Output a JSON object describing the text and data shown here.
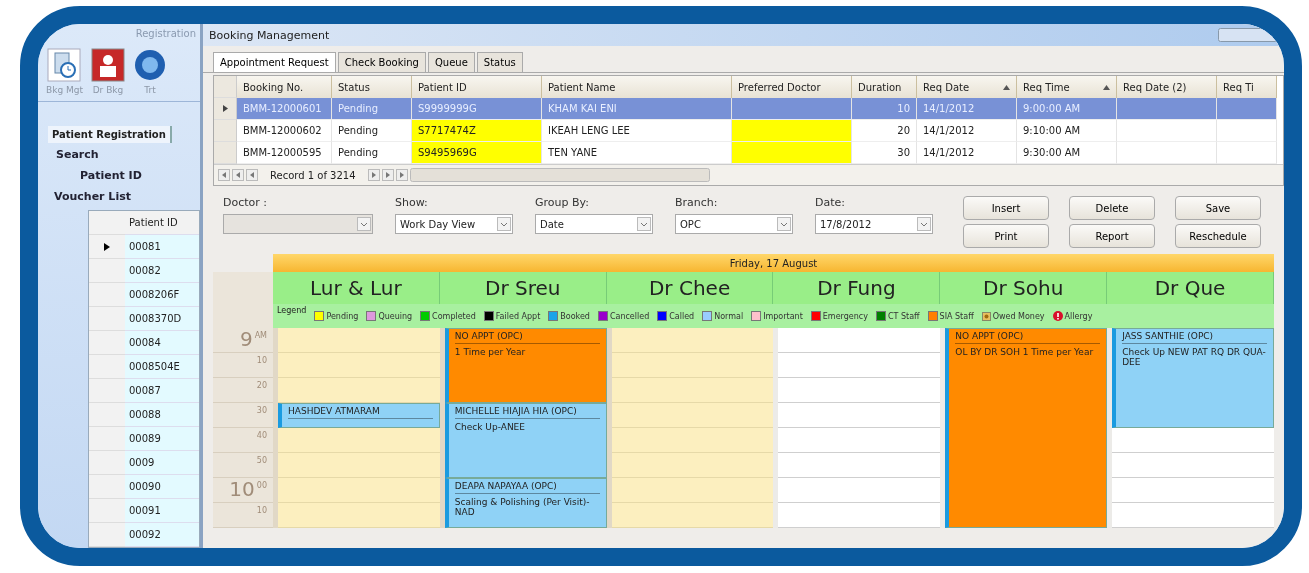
{
  "sidebar": {
    "ribbon_title": "Registration",
    "ribbon_buttons": [
      {
        "label": "Bkg Mgt",
        "kind": "clock"
      },
      {
        "label": "Dr Bkg",
        "kind": "doctor"
      },
      {
        "label": "Trt",
        "kind": "globe"
      }
    ],
    "tab": "Patient Registration",
    "search_title": "Search",
    "search_label": "Patient ID",
    "voucher_title": "Voucher List",
    "voucher_column": "Patient ID",
    "vouchers": [
      {
        "id": "00081",
        "selected": true
      },
      {
        "id": "00082",
        "selected": false
      },
      {
        "id": "0008206F",
        "selected": false
      },
      {
        "id": "0008370D",
        "selected": false
      },
      {
        "id": "00084",
        "selected": false
      },
      {
        "id": "0008504E",
        "selected": false
      },
      {
        "id": "00087",
        "selected": false
      },
      {
        "id": "00088",
        "selected": false
      },
      {
        "id": "00089",
        "selected": false
      },
      {
        "id": "0009",
        "selected": false
      },
      {
        "id": "00090",
        "selected": false
      },
      {
        "id": "00091",
        "selected": false
      },
      {
        "id": "00092",
        "selected": false
      }
    ]
  },
  "booking": {
    "title": "Booking Management",
    "tabs": [
      {
        "label": "Appointment Request",
        "selected": true
      },
      {
        "label": "Check Booking",
        "selected": false
      },
      {
        "label": "Queue",
        "selected": false
      },
      {
        "label": "Status",
        "selected": false
      }
    ],
    "table": {
      "columns": [
        {
          "label": "Booking No.",
          "sorted": false
        },
        {
          "label": "Status",
          "sorted": false
        },
        {
          "label": "Patient ID",
          "sorted": false
        },
        {
          "label": "Patient Name",
          "sorted": false
        },
        {
          "label": "Preferred Doctor",
          "sorted": false
        },
        {
          "label": "Duration",
          "sorted": false
        },
        {
          "label": "Req Date",
          "sorted": true
        },
        {
          "label": "Req Time",
          "sorted": true
        },
        {
          "label": "Req Date (2)",
          "sorted": false
        },
        {
          "label": "Req Ti",
          "sorted": false
        }
      ],
      "rows": [
        {
          "selected": true,
          "flagged": false,
          "cells": [
            "BMM-12000601",
            "Pending",
            "S9999999G",
            "KHAM KAI ENI",
            null,
            "10",
            "14/1/2012",
            "9:00:00 AM",
            null,
            null
          ]
        },
        {
          "selected": false,
          "flagged": true,
          "cells": [
            "BMM-12000602",
            "Pending",
            "S7717474Z",
            "IKEAH LENG LEE",
            null,
            "20",
            "14/1/2012",
            "9:10:00 AM",
            null,
            null
          ]
        },
        {
          "selected": false,
          "flagged": true,
          "cells": [
            "BMM-12000595",
            "Pending",
            "S9495969G",
            "TEN YANE",
            null,
            "30",
            "14/1/2012",
            "9:30:00 AM",
            null,
            null
          ]
        }
      ]
    },
    "record": "Record 1 of 3214",
    "filters": [
      {
        "label": "Doctor :",
        "disabled": true
      },
      {
        "label": "Show:",
        "value": "Work Day View",
        "disabled": false
      },
      {
        "label": "Group By:",
        "value": "Date",
        "disabled": false
      },
      {
        "label": "Branch:",
        "value": "OPC",
        "disabled": false
      },
      {
        "label": "Date:",
        "value": "17/8/2012",
        "disabled": false
      }
    ],
    "buttons": [
      "Insert",
      "Delete",
      "Save",
      "Print",
      "Report",
      "Reschedule"
    ]
  },
  "scheduler": {
    "date": "Friday, 17 August",
    "legend_title": "Legend",
    "legend": [
      {
        "label": "Pending",
        "kind": "swatch",
        "color": "#ffff00"
      },
      {
        "label": "Queuing",
        "kind": "swatch",
        "color": "#dd99dd"
      },
      {
        "label": "Completed",
        "kind": "swatch",
        "color": "#00cc00"
      },
      {
        "label": "Failed Appt",
        "kind": "swatch",
        "color": "#000000"
      },
      {
        "label": "Booked",
        "kind": "swatch",
        "color": "#1aa3e8"
      },
      {
        "label": "Cancelled",
        "kind": "swatch",
        "color": "#9900cc"
      },
      {
        "label": "Called",
        "kind": "swatch",
        "color": "#0000ff"
      },
      {
        "label": "Normal",
        "kind": "swatch",
        "color": "#99ccff"
      },
      {
        "label": "Important",
        "kind": "swatch",
        "color": "#ffc0cb"
      },
      {
        "label": "Emergency",
        "kind": "swatch",
        "color": "#ff0000"
      },
      {
        "label": "CT Staff",
        "kind": "swatch",
        "color": "#008000"
      },
      {
        "label": "SIA Staff",
        "kind": "swatch",
        "color": "#ff8000"
      },
      {
        "label": "Owed Money",
        "kind": "coin"
      },
      {
        "label": "Allergy",
        "kind": "alert"
      }
    ],
    "slots": [
      {
        "hour": "9",
        "minute": "AM"
      },
      {
        "minute": "10"
      },
      {
        "minute": "20"
      },
      {
        "minute": "30"
      },
      {
        "minute": "40"
      },
      {
        "minute": "50"
      },
      {
        "hour": "10",
        "minute": "00"
      },
      {
        "minute": "10"
      }
    ],
    "doctors": [
      {
        "name": "Lur & Lur",
        "working": true,
        "slots": [
          {
            "kind": "free"
          },
          {
            "kind": "free"
          },
          {
            "kind": "free"
          },
          {
            "kind": "booked",
            "title": "HASHDEV ATMARAM"
          },
          {
            "kind": "free"
          },
          {
            "kind": "free"
          },
          {
            "kind": "free"
          },
          {
            "kind": "free"
          }
        ]
      },
      {
        "name": "Dr Sreu",
        "working": true,
        "slots": [
          {
            "kind": "staff",
            "title": "NO APPT (OPC)",
            "note": "1 Time per Year"
          },
          {
            "kind": "continued"
          },
          {
            "kind": "continued"
          },
          {
            "kind": "booked",
            "title": "MICHELLE HIAJIA HIA (OPC)",
            "note": "Check Up-ANEE"
          },
          {
            "kind": "continued"
          },
          {
            "kind": "continued"
          },
          {
            "kind": "booked",
            "title": "DEAPA NAPAYAA (OPC)",
            "note": "Scaling & Polishing (Per Visit)- NAD"
          },
          {
            "kind": "continued"
          }
        ]
      },
      {
        "name": "Dr Chee",
        "working": true,
        "slots": [
          {
            "kind": "free"
          },
          {
            "kind": "free"
          },
          {
            "kind": "free"
          },
          {
            "kind": "free"
          },
          {
            "kind": "free"
          },
          {
            "kind": "free"
          },
          {
            "kind": "free"
          },
          {
            "kind": "free"
          }
        ]
      },
      {
        "name": "Dr Fung",
        "working": false,
        "slots": [
          {
            "kind": "free"
          },
          {
            "kind": "free"
          },
          {
            "kind": "free"
          },
          {
            "kind": "free"
          },
          {
            "kind": "free"
          },
          {
            "kind": "free"
          },
          {
            "kind": "free"
          },
          {
            "kind": "free"
          }
        ]
      },
      {
        "name": "Dr Sohu",
        "working": false,
        "slots": [
          {
            "kind": "staff",
            "title": "NO APPT (OPC)",
            "note": "OL BY DR SOH 1 Time per Year"
          },
          {
            "kind": "continued"
          },
          {
            "kind": "continued"
          },
          {
            "kind": "continued"
          },
          {
            "kind": "continued"
          },
          {
            "kind": "continued"
          },
          {
            "kind": "continued"
          },
          {
            "kind": "continued"
          }
        ]
      },
      {
        "name": "Dr Que",
        "working": false,
        "slots": [
          {
            "kind": "booked",
            "title": "JASS SANTHIE (OPC)",
            "note": "Check Up NEW PAT RQ DR QUA-DEE"
          },
          {
            "kind": "continued"
          },
          {
            "kind": "continued"
          },
          {
            "kind": "continued"
          },
          {
            "kind": "free"
          },
          {
            "kind": "free"
          },
          {
            "kind": "free"
          },
          {
            "kind": "free"
          }
        ]
      }
    ]
  }
}
